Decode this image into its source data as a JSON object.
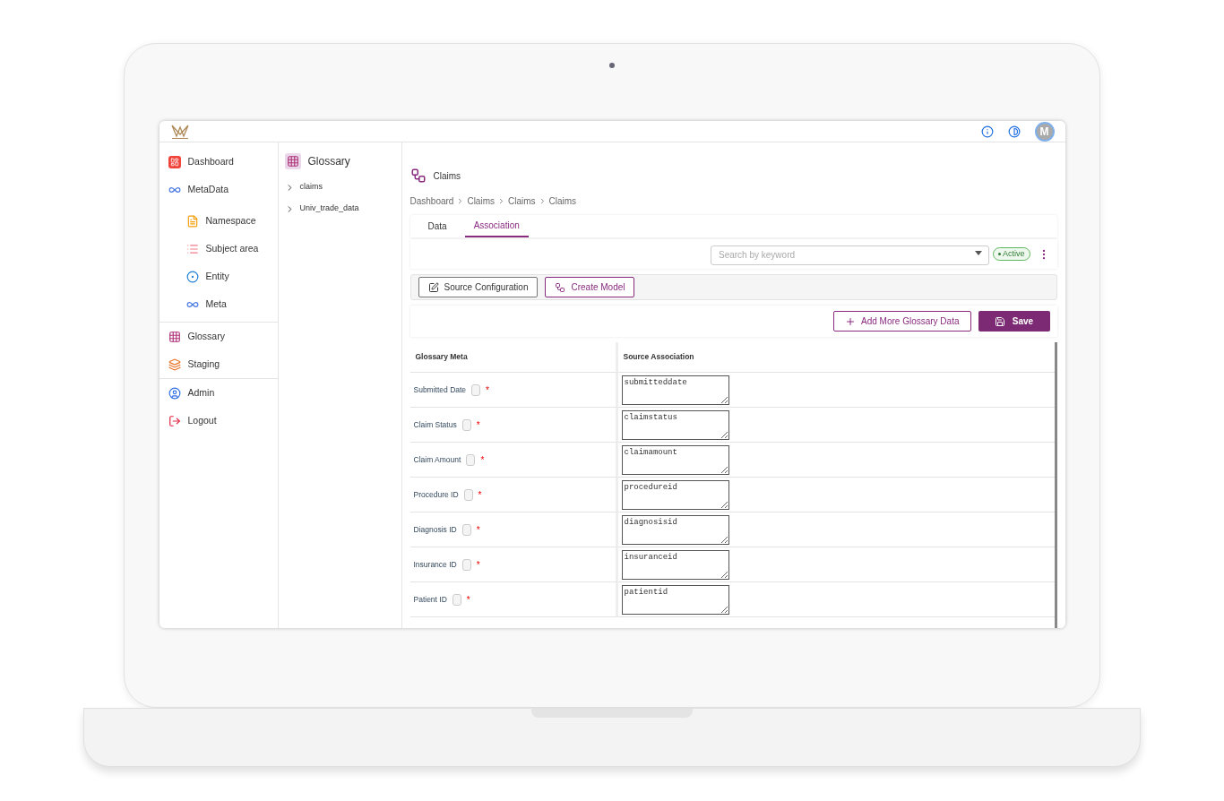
{
  "header": {
    "avatar": "M"
  },
  "sidebar": {
    "sections": [
      {
        "items": [
          {
            "label": "Dashboard",
            "kind": "dashboard"
          },
          {
            "label": "MetaData",
            "kind": "metadata",
            "children": [
              {
                "label": "Namespace",
                "kind": "namespace"
              },
              {
                "label": "Subject area",
                "kind": "subject"
              },
              {
                "label": "Entity",
                "kind": "entity"
              },
              {
                "label": "Meta",
                "kind": "meta"
              }
            ]
          }
        ]
      },
      {
        "items": [
          {
            "label": "Glossary",
            "kind": "glossary"
          },
          {
            "label": "Staging",
            "kind": "staging"
          }
        ]
      },
      {
        "items": [
          {
            "label": "Admin",
            "kind": "admin"
          },
          {
            "label": "Logout",
            "kind": "logout"
          }
        ]
      }
    ]
  },
  "tree": {
    "title": "Glossary",
    "items": [
      {
        "label": "claims",
        "expanded": false
      },
      {
        "label": "Univ_trade_data",
        "expanded": false
      }
    ]
  },
  "page": {
    "title": "Claims",
    "breadcrumb": [
      "Dashboard",
      "Claims",
      "Claims",
      "Claims"
    ]
  },
  "tabs": [
    {
      "label": "Data",
      "selected": false
    },
    {
      "label": "Association",
      "selected": true
    }
  ],
  "filter": {
    "placeholder": "Search by keyword",
    "status": "Active"
  },
  "toolbar": [
    "Source Configuration",
    "Create Model"
  ],
  "actions": {
    "add": "Add More Glossary Data",
    "save": "Save"
  },
  "table": {
    "columns": [
      "Glossary Meta",
      "Source Association"
    ],
    "rows": [
      {
        "meta": "Submitted Date",
        "checked": false,
        "required": "*",
        "source": "submitteddate"
      },
      {
        "meta": "Claim Status",
        "checked": false,
        "required": "*",
        "source": "claimstatus"
      },
      {
        "meta": "Claim Amount",
        "checked": false,
        "required": "*",
        "source": "claimamount"
      },
      {
        "meta": "Procedure ID",
        "checked": false,
        "required": "*",
        "source": "procedureid"
      },
      {
        "meta": "Diagnosis ID",
        "checked": false,
        "required": "*",
        "source": "diagnosisid"
      },
      {
        "meta": "Insurance ID",
        "checked": false,
        "required": "*",
        "source": "insuranceid"
      },
      {
        "meta": "Patient ID",
        "checked": false,
        "required": "*",
        "source": "patientid"
      }
    ]
  }
}
